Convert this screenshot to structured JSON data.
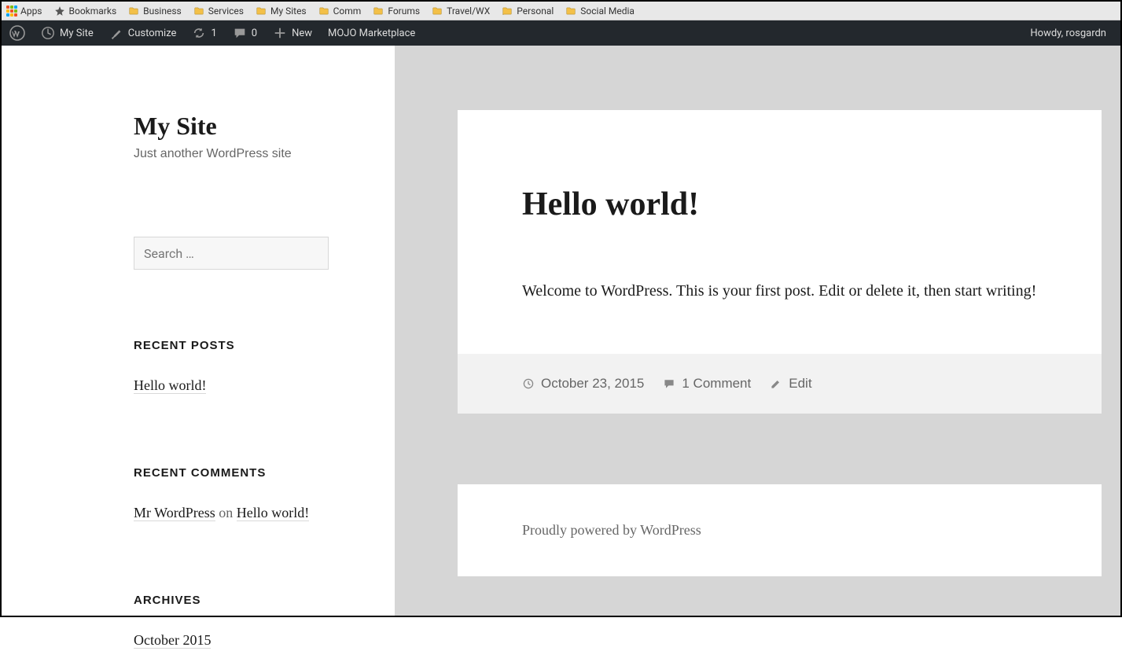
{
  "bookmarks": {
    "apps": "Apps",
    "items": [
      {
        "icon": "star",
        "label": "Bookmarks"
      },
      {
        "icon": "folder",
        "label": "Business"
      },
      {
        "icon": "folder",
        "label": "Services"
      },
      {
        "icon": "folder",
        "label": "My Sites"
      },
      {
        "icon": "folder",
        "label": "Comm"
      },
      {
        "icon": "folder",
        "label": "Forums"
      },
      {
        "icon": "folder",
        "label": "Travel/WX"
      },
      {
        "icon": "folder",
        "label": "Personal"
      },
      {
        "icon": "folder",
        "label": "Social Media"
      }
    ]
  },
  "adminbar": {
    "mysite": "My Site",
    "customize": "Customize",
    "updates_count": "1",
    "comments_count": "0",
    "new": "New",
    "mojo": "MOJO Marketplace",
    "howdy": "Howdy, rosgardn"
  },
  "sidebar": {
    "site_title": "My Site",
    "site_desc": "Just another WordPress site",
    "search_placeholder": "Search …",
    "recent_posts_title": "RECENT POSTS",
    "recent_posts": [
      "Hello world!"
    ],
    "recent_comments_title": "RECENT COMMENTS",
    "recent_comments_author": "Mr WordPress",
    "recent_comments_on": " on ",
    "recent_comments_post": "Hello world!",
    "archives_title": "ARCHIVES",
    "archives": [
      "October 2015"
    ]
  },
  "post": {
    "title": "Hello world!",
    "body": "Welcome to WordPress. This is your first post. Edit or delete it, then start writing!",
    "date": "October 23, 2015",
    "comments": "1 Comment",
    "edit": "Edit"
  },
  "footer": {
    "text": "Proudly powered by WordPress"
  }
}
